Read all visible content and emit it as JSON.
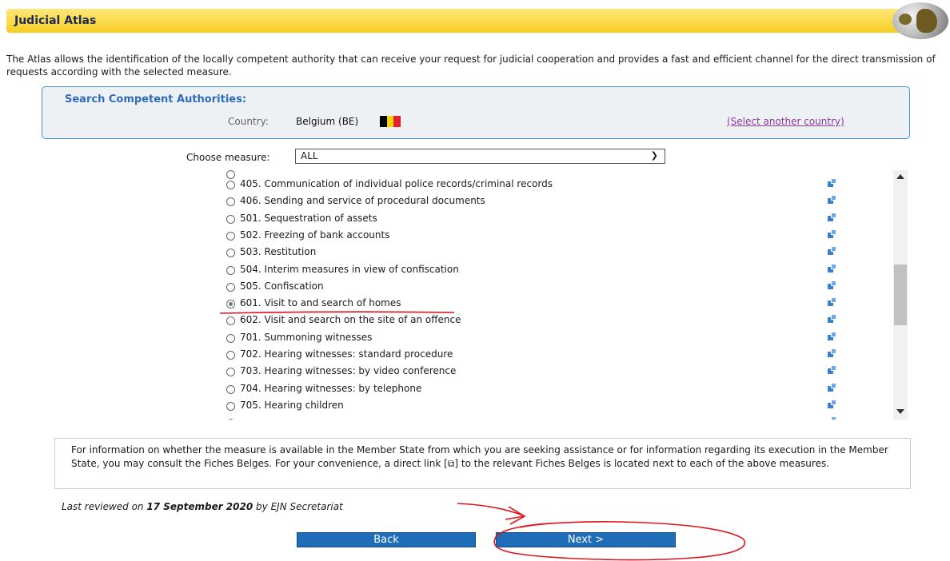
{
  "header": {
    "title": "Judicial Atlas"
  },
  "intro": "The Atlas allows the identification of the locally competent authority that can receive your request for judicial cooperation and provides a fast and efficient channel for the direct transmission of requests according with the selected measure.",
  "search": {
    "title": "Search Competent Authorities:",
    "country_label": "Country:",
    "country_value": "Belgium (BE)",
    "select_another": "(Select another country)",
    "flag_colors": [
      "#000000",
      "#f5d20a",
      "#e5202a"
    ]
  },
  "measure": {
    "label": "Choose measure:",
    "selected": "ALL"
  },
  "list": {
    "items": [
      {
        "label": "405. Communication of individual police records/criminal records",
        "checked": false
      },
      {
        "label": "406. Sending and service of procedural documents",
        "checked": false
      },
      {
        "label": "501. Sequestration of assets",
        "checked": false
      },
      {
        "label": "502. Freezing of bank accounts",
        "checked": false
      },
      {
        "label": "503. Restitution",
        "checked": false
      },
      {
        "label": "504. Interim measures in view of confiscation",
        "checked": false
      },
      {
        "label": "505. Confiscation",
        "checked": false
      },
      {
        "label": "601. Visit to and search of homes",
        "checked": true
      },
      {
        "label": "602. Visit and search on the site of an offence",
        "checked": false
      },
      {
        "label": "701. Summoning witnesses",
        "checked": false
      },
      {
        "label": "702. Hearing witnesses: standard procedure",
        "checked": false
      },
      {
        "label": "703. Hearing witnesses: by video conference",
        "checked": false
      },
      {
        "label": "704. Hearing witnesses: by telephone",
        "checked": false
      },
      {
        "label": "705. Hearing children",
        "checked": false
      }
    ]
  },
  "info": "For information on whether the measure is available in the Member State from which you are seeking assistance or for information regarding its execution in the Member State, you may consult the Fiches Belges. For your convenience, a direct link [⧉] to the relevant Fiches Belges is located next to each of the above measures.",
  "reviewed": {
    "prefix": "Last reviewed on",
    "date": "17 September 2020",
    "suffix": "by EJN Secretariat"
  },
  "buttons": {
    "back": "Back",
    "next": "Next >"
  },
  "colors": {
    "accent": "#1f6cb8",
    "header": "#f6cd24",
    "annotation": "#e0141e"
  }
}
